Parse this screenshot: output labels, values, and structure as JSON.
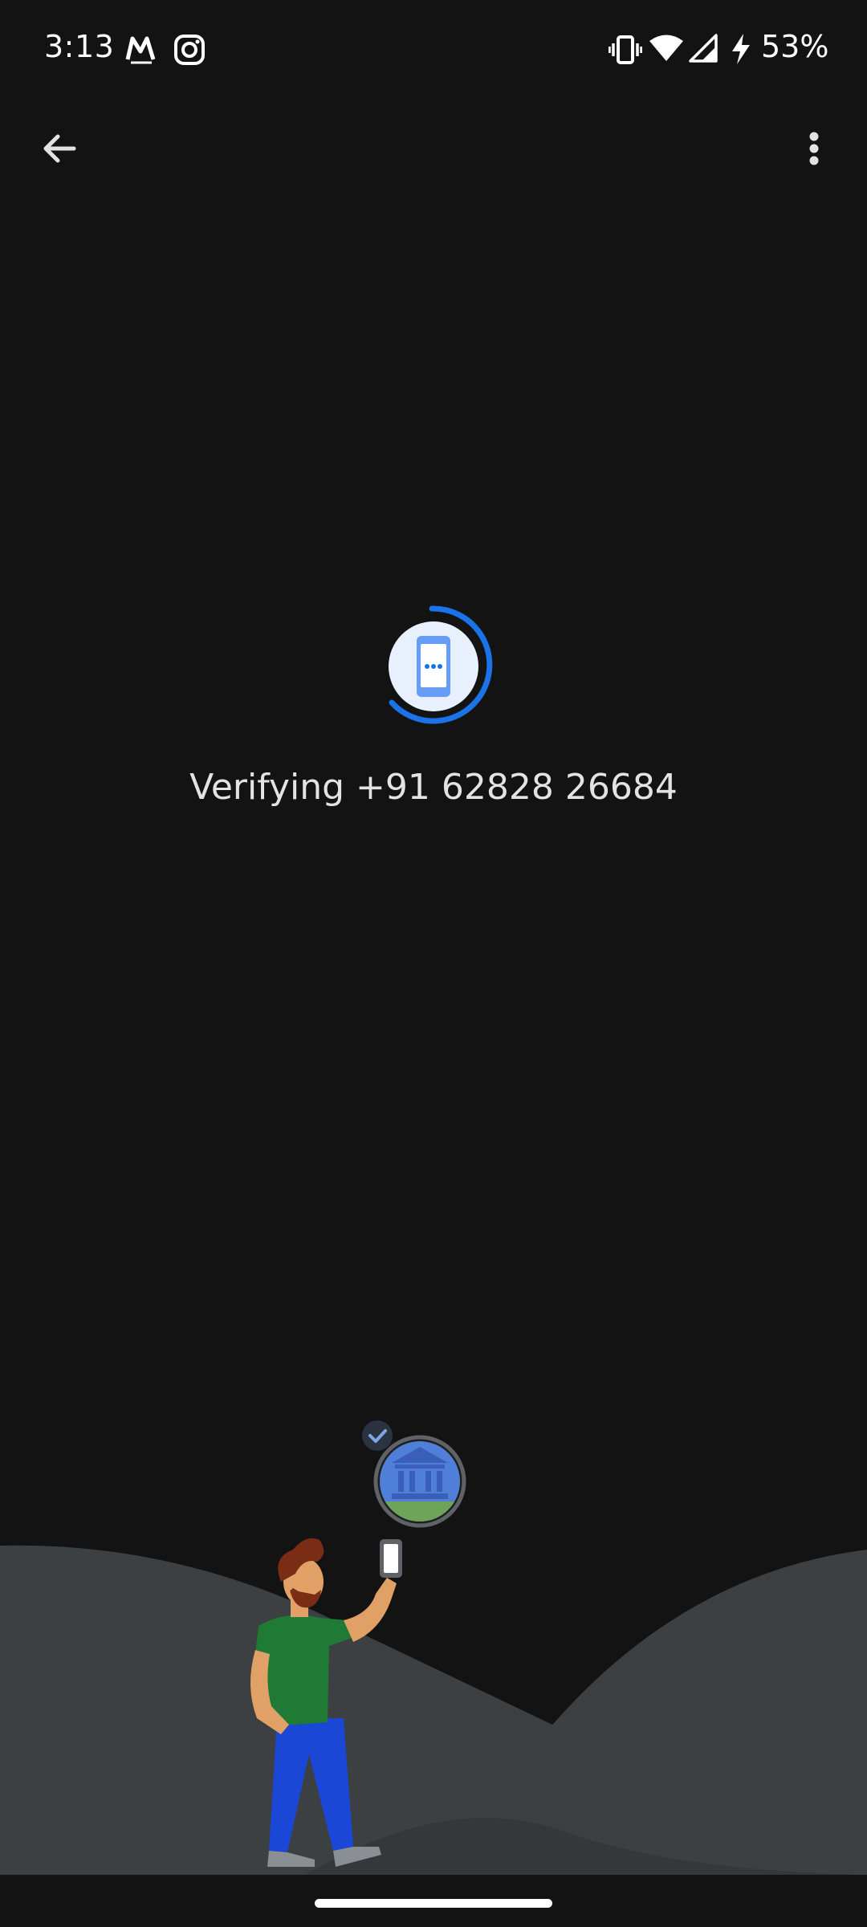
{
  "status_bar": {
    "time": "3:13",
    "notification_icons": [
      "myntra-icon",
      "instagram-icon"
    ],
    "system_icons": [
      "vibrate-icon",
      "wifi-icon",
      "cell-signal-icon",
      "charging-icon"
    ],
    "battery": "53%"
  },
  "app_bar": {
    "back_icon": "arrow-back-icon",
    "menu_icon": "more-vert-icon"
  },
  "verification": {
    "label": "Verifying",
    "phone_number": "+91 62828 26684"
  },
  "colors": {
    "background": "#131314",
    "accent": "#1a73e8",
    "text": "#e3e3e3",
    "hill": "#3c4043"
  }
}
